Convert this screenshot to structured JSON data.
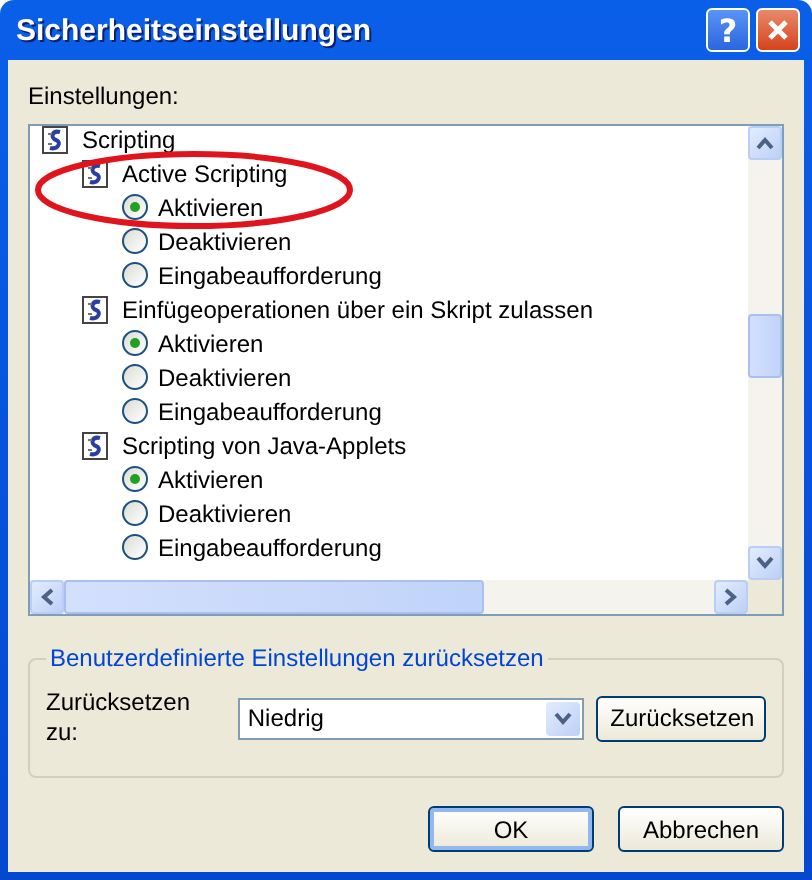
{
  "window": {
    "title": "Sicherheitseinstellungen",
    "help": "?"
  },
  "settings_label": "Einstellungen:",
  "settings": [
    {
      "label": "Scripting",
      "children": [
        {
          "label": "Active Scripting",
          "options": [
            {
              "label": "Aktivieren",
              "selected": true
            },
            {
              "label": "Deaktivieren",
              "selected": false
            },
            {
              "label": "Eingabeaufforderung",
              "selected": false
            }
          ]
        },
        {
          "label": "Einfügeoperationen über ein Skript zulassen",
          "options": [
            {
              "label": "Aktivieren",
              "selected": true
            },
            {
              "label": "Deaktivieren",
              "selected": false
            },
            {
              "label": "Eingabeaufforderung",
              "selected": false
            }
          ]
        },
        {
          "label": "Scripting von Java-Applets",
          "options": [
            {
              "label": "Aktivieren",
              "selected": true
            },
            {
              "label": "Deaktivieren",
              "selected": false
            },
            {
              "label": "Eingabeaufforderung",
              "selected": false
            }
          ]
        }
      ]
    }
  ],
  "reset": {
    "title": "Benutzerdefinierte Einstellungen zurücksetzen",
    "label": "Zurücksetzen zu:",
    "value": "Niedrig",
    "button": "Zurücksetzen"
  },
  "buttons": [
    "OK",
    "Abbrechen"
  ]
}
